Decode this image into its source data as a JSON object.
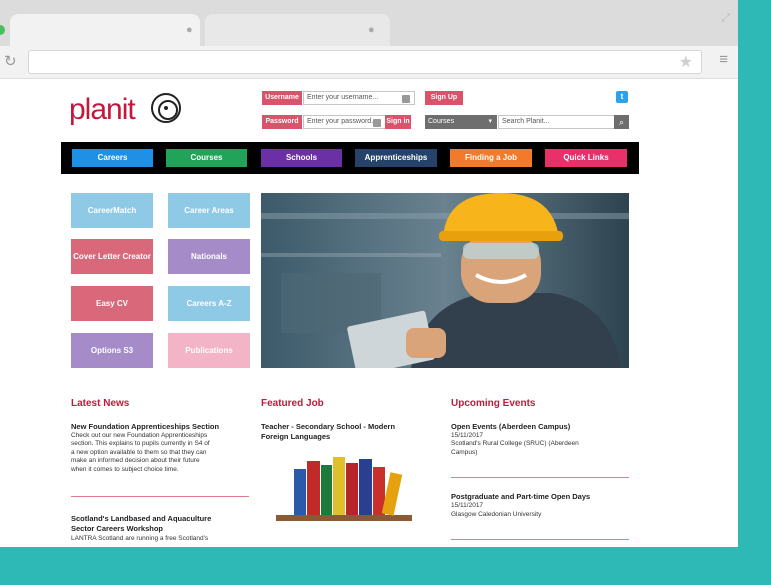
{
  "header": {
    "logo_text": "planit",
    "username_label": "Username",
    "username_placeholder": "Enter your username...",
    "password_label": "Password",
    "password_placeholder": "Enter your password...",
    "sign_up": "Sign Up",
    "sign_in": "Sign in",
    "courses_select": "Courses",
    "search_placeholder": "Search Planit..."
  },
  "nav": [
    {
      "label": "Careers",
      "color": "#1e90e6"
    },
    {
      "label": "Courses",
      "color": "#21a35a"
    },
    {
      "label": "Schools",
      "color": "#6b2fa6"
    },
    {
      "label": "Apprenticeships",
      "color": "#25426b"
    },
    {
      "label": "Finding a Job",
      "color": "#f27a2a"
    },
    {
      "label": "Quick Links",
      "color": "#e8306b"
    }
  ],
  "tiles": [
    {
      "label": "CareerMatch",
      "color": "#8ecae6"
    },
    {
      "label": "Career Areas",
      "color": "#8ecae6"
    },
    {
      "label": "Cover Letter Creator",
      "color": "#d9697a"
    },
    {
      "label": "Nationals",
      "color": "#a58cc9"
    },
    {
      "label": "Easy CV",
      "color": "#d9697a"
    },
    {
      "label": "Careers A-Z",
      "color": "#8ecae6"
    },
    {
      "label": "Options S3",
      "color": "#a58cc9"
    },
    {
      "label": "Publications",
      "color": "#f4b4c8"
    }
  ],
  "latest_news": {
    "title": "Latest News",
    "item1_title": "New Foundation Apprenticeships Section",
    "item1_lines": [
      "Check out our new Foundation Apprenticeships",
      "section. This explains to pupils currently in S4 of",
      "a new option available to them so that they can",
      "make an informed decision about their future",
      "when it comes to subject choice time."
    ],
    "item2_title_1": "Scotland's Landbased and Aquaculture",
    "item2_title_2": "Sector Careers Workshop",
    "item2_line": "LANTRA Scotland are running a free Scotland's"
  },
  "featured_job": {
    "title": "Featured Job",
    "job_title_1": "Teacher - Secondary School - Modern",
    "job_title_2": "Foreign Languages"
  },
  "events": {
    "title": "Upcoming Events",
    "e1_title": "Open Events (Aberdeen Campus)",
    "e1_date": "15/11/2017",
    "e1_loc_1": "Scotland's Rural College (SRUC) (Aberdeen",
    "e1_loc_2": "Campus)",
    "e2_title": "Postgraduate and Part-time Open Days",
    "e2_date": "15/11/2017",
    "e2_loc": "Glasgow Caledonian University"
  }
}
